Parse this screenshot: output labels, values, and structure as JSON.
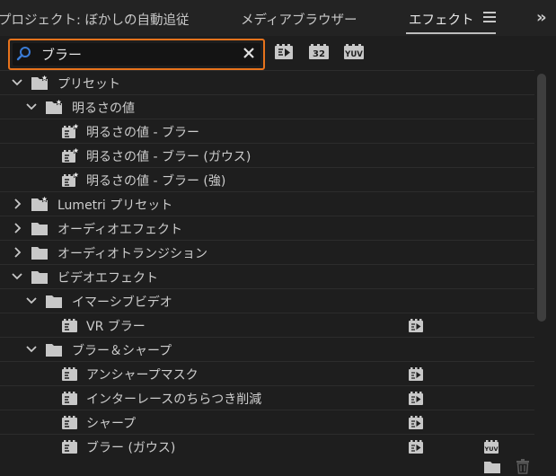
{
  "tabs": [
    {
      "label": "プロジェクト: ぼかしの自動追従",
      "active": false
    },
    {
      "label": "メディアブラウザー",
      "active": false
    },
    {
      "label": "エフェクト",
      "active": true
    }
  ],
  "search": {
    "value": "ブラー",
    "placeholder": ""
  },
  "toolbar": {
    "accelerated_icon": "accelerated-effects-icon",
    "bit32_label": "32",
    "yuv_label": "YUV"
  },
  "tree": [
    {
      "label": "プリセット",
      "depth": 0,
      "expanded": true,
      "icon": "preset-folder-icon"
    },
    {
      "label": "明るさの値",
      "depth": 1,
      "expanded": true,
      "icon": "preset-folder-icon"
    },
    {
      "label": "明るさの値 - ブラー",
      "depth": 2,
      "icon": "preset-effect-icon"
    },
    {
      "label": "明るさの値 - ブラー (ガウス)",
      "depth": 2,
      "icon": "preset-effect-icon"
    },
    {
      "label": "明るさの値 - ブラー (強)",
      "depth": 2,
      "icon": "preset-effect-icon"
    },
    {
      "label": "Lumetri プリセット",
      "depth": 0,
      "expanded": false,
      "icon": "preset-folder-icon"
    },
    {
      "label": "オーディオエフェクト",
      "depth": 0,
      "expanded": false,
      "icon": "folder-icon"
    },
    {
      "label": "オーディオトランジション",
      "depth": 0,
      "expanded": false,
      "icon": "folder-icon"
    },
    {
      "label": "ビデオエフェクト",
      "depth": 0,
      "expanded": true,
      "icon": "folder-icon"
    },
    {
      "label": "イマーシブビデオ",
      "depth": 1,
      "expanded": true,
      "icon": "folder-icon"
    },
    {
      "label": "VR ブラー",
      "depth": 2,
      "icon": "effect-icon",
      "accelerated": true
    },
    {
      "label": "ブラー＆シャープ",
      "depth": 1,
      "expanded": true,
      "icon": "folder-icon"
    },
    {
      "label": "アンシャープマスク",
      "depth": 2,
      "icon": "effect-icon",
      "accelerated": true
    },
    {
      "label": "インターレースのちらつき削減",
      "depth": 2,
      "icon": "effect-icon",
      "accelerated": true
    },
    {
      "label": "シャープ",
      "depth": 2,
      "icon": "effect-icon",
      "accelerated": true
    },
    {
      "label": "ブラー (ガウス)",
      "depth": 2,
      "icon": "effect-icon",
      "accelerated": true,
      "yuv": true
    }
  ],
  "footer": {
    "new_folder_icon": "new-folder-icon",
    "delete_icon": "trash-icon"
  },
  "colors": {
    "search_border": "#e8731c",
    "search_icon": "#3a7bd5",
    "background": "#1e1e1e"
  }
}
